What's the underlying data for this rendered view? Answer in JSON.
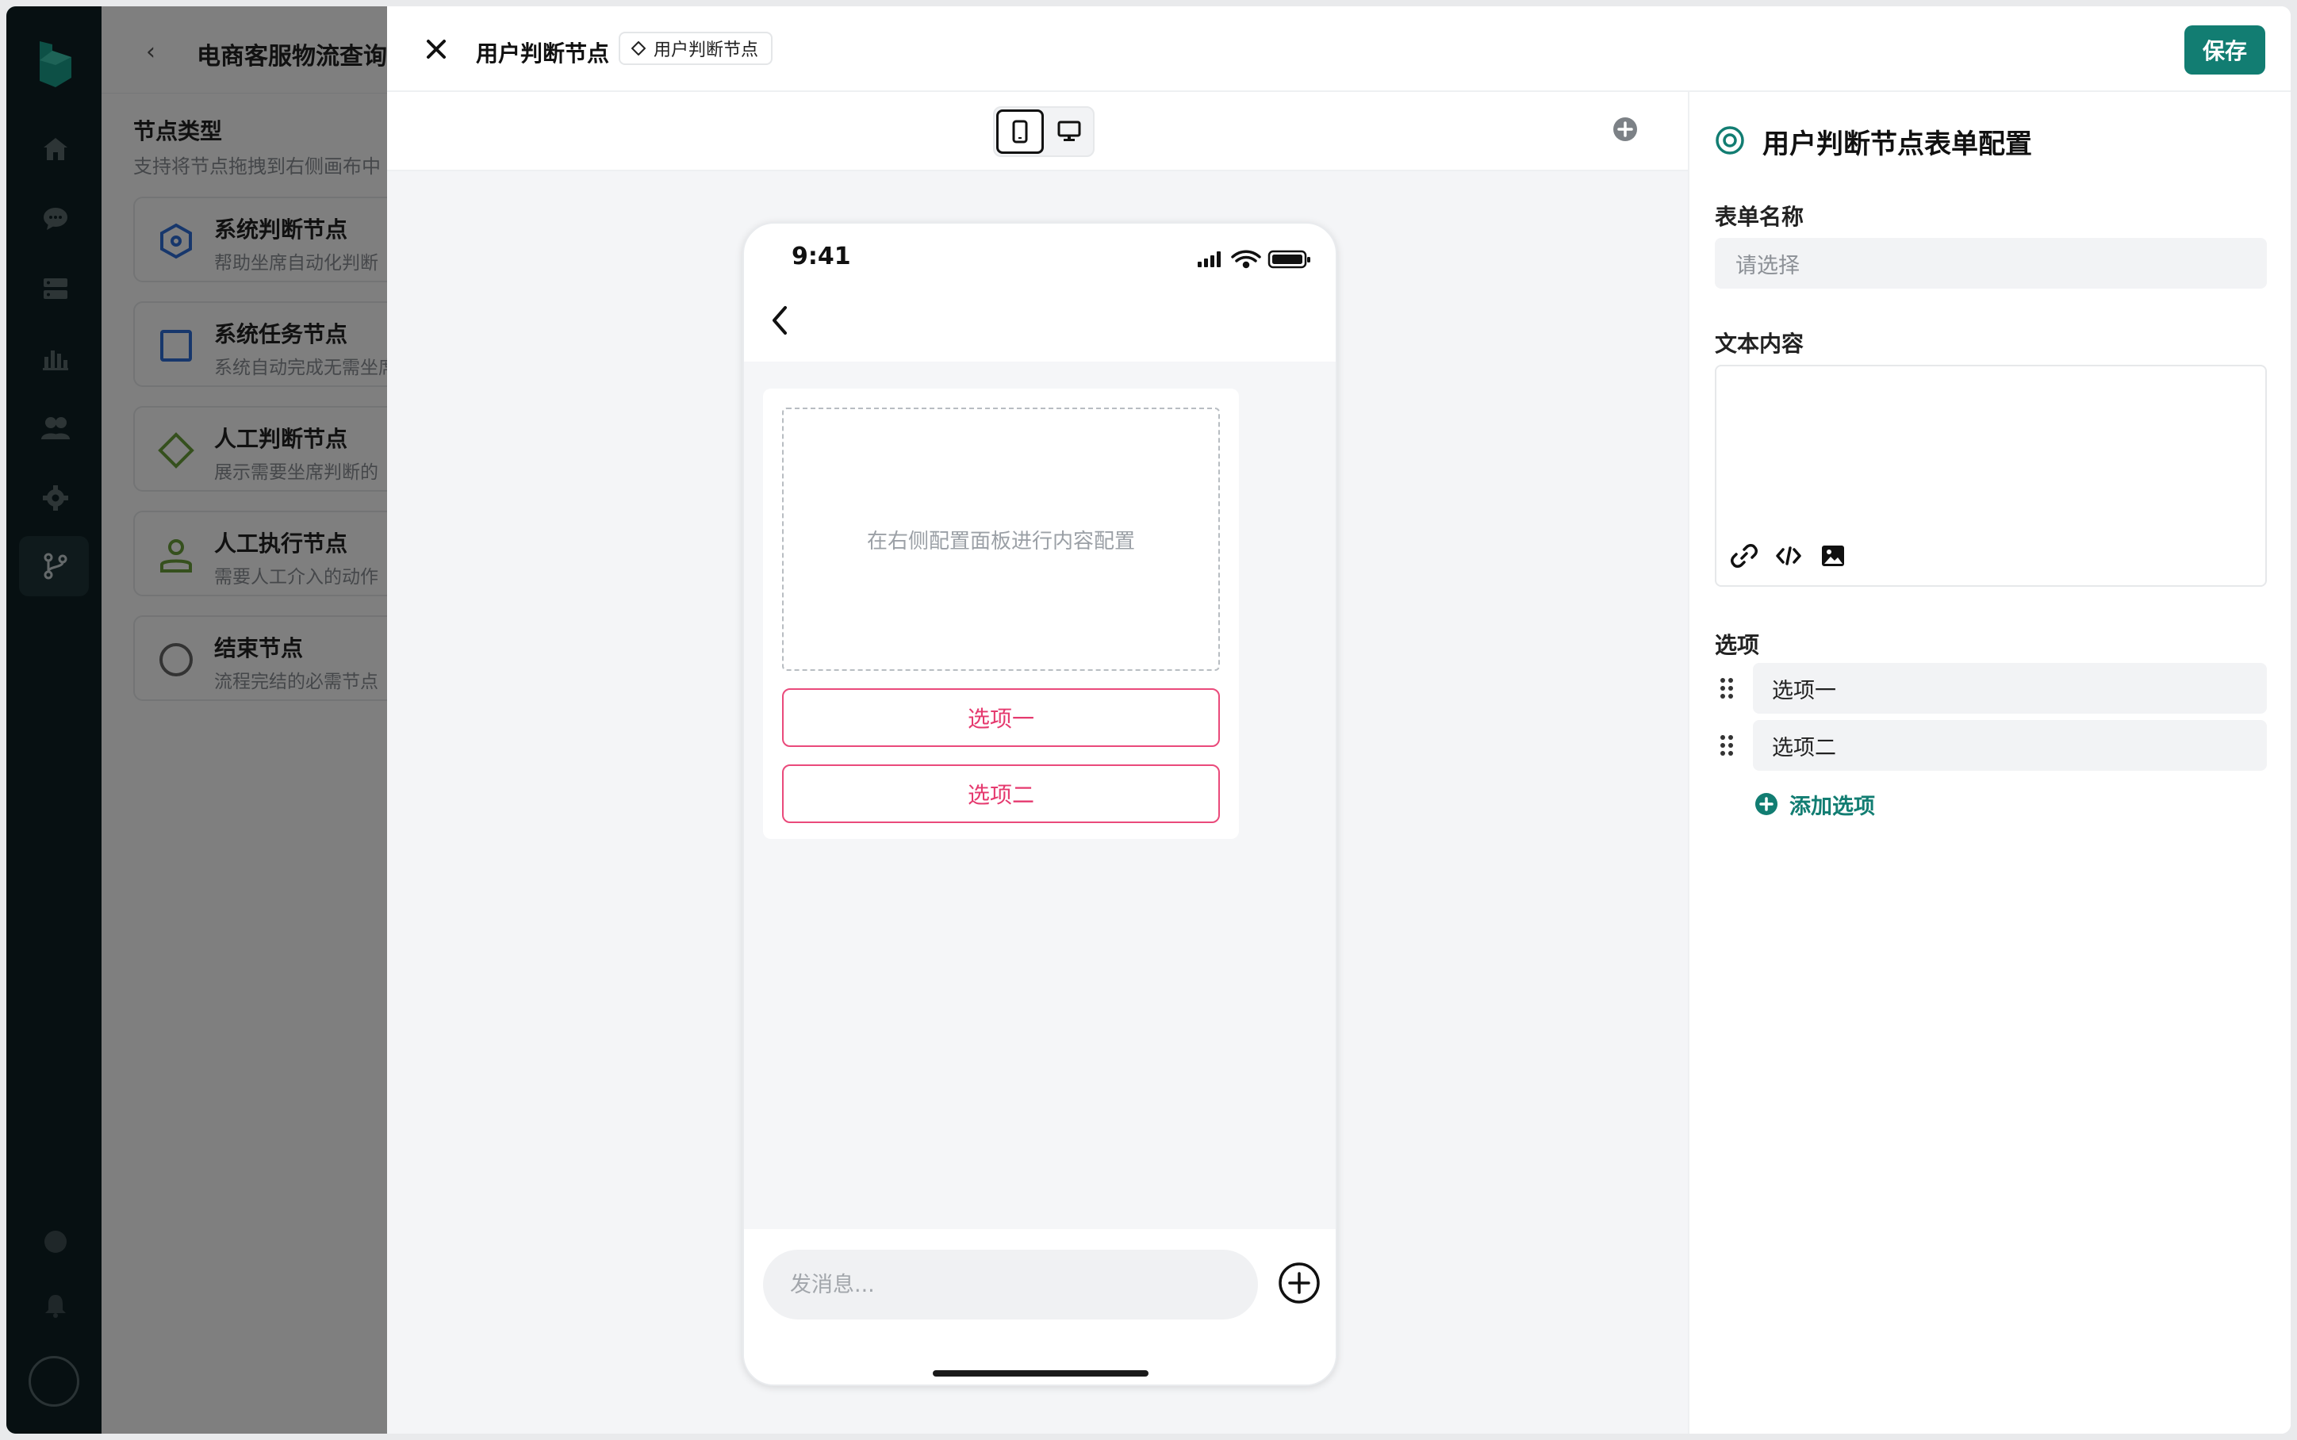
{
  "app": {
    "bg_title": "电商客服物流查询 SOP",
    "node_types": {
      "header": "节点类型",
      "subtitle": "支持将节点拖拽到右侧画布中",
      "items": [
        {
          "title": "系统判断节点",
          "desc": "帮助坐席自动化判断",
          "icon": "hexagon-icon",
          "color": "#2f6fd8"
        },
        {
          "title": "系统任务节点",
          "desc": "系统自动完成无需坐席",
          "icon": "square-icon",
          "color": "#2f6fd8"
        },
        {
          "title": "人工判断节点",
          "desc": "展示需要坐席判断的",
          "icon": "diamond-icon",
          "color": "#6aa03a"
        },
        {
          "title": "人工执行节点",
          "desc": "需要人工介入的动作",
          "icon": "person-icon",
          "color": "#6aa03a"
        },
        {
          "title": "结束节点",
          "desc": "流程完结的必需节点",
          "icon": "circle-icon",
          "color": "#666666"
        }
      ]
    }
  },
  "drawer": {
    "title": "用户判断节点",
    "tag": "用户判断节点",
    "save_label": "保存"
  },
  "phone": {
    "time": "9:41",
    "placeholder_text": "在右侧配置面板进行内容配置",
    "options": [
      "选项一",
      "选项二"
    ],
    "message_placeholder": "发消息..."
  },
  "config": {
    "title": "用户判断节点表单配置",
    "form_name_label": "表单名称",
    "form_name_placeholder": "请选择",
    "text_content_label": "文本内容",
    "options_label": "选项",
    "options": [
      "选项一",
      "选项二"
    ],
    "add_option_label": "添加选项"
  },
  "colors": {
    "accent": "#127d72",
    "option_pink": "#e53a6f",
    "rail": "#0f2124"
  }
}
